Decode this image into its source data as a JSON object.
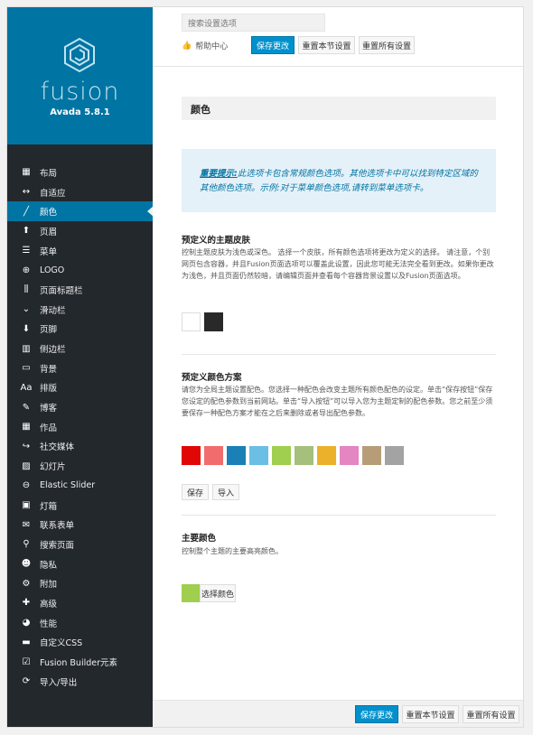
{
  "brand": {
    "name": "fusion",
    "version": "Avada 5.8.1"
  },
  "nav": [
    {
      "label": "布局",
      "icon": "grid-icon",
      "glyph": "▦"
    },
    {
      "label": "自适应",
      "icon": "arrows-horizontal-icon",
      "glyph": "↔"
    },
    {
      "label": "颜色",
      "icon": "brush-icon",
      "glyph": "╱",
      "active": true
    },
    {
      "label": "页眉",
      "icon": "arrow-up-icon",
      "glyph": "⬆"
    },
    {
      "label": "菜单",
      "icon": "menu-icon",
      "glyph": "☰"
    },
    {
      "label": "LOGO",
      "icon": "plus-circle-icon",
      "glyph": "⊕"
    },
    {
      "label": "页面标题栏",
      "icon": "sliders-icon",
      "glyph": "⫼"
    },
    {
      "label": "滑动栏",
      "icon": "chevron-down-icon",
      "glyph": "⌄"
    },
    {
      "label": "页脚",
      "icon": "arrow-down-icon",
      "glyph": "⬇"
    },
    {
      "label": "侧边栏",
      "icon": "columns-icon",
      "glyph": "▥"
    },
    {
      "label": "背景",
      "icon": "monitor-icon",
      "glyph": "▭"
    },
    {
      "label": "排版",
      "icon": "typography-icon",
      "glyph": "Aa"
    },
    {
      "label": "博客",
      "icon": "edit-icon",
      "glyph": "✎"
    },
    {
      "label": "作品",
      "icon": "portfolio-grid-icon",
      "glyph": "▦"
    },
    {
      "label": "社交媒体",
      "icon": "share-icon",
      "glyph": "↪"
    },
    {
      "label": "幻灯片",
      "icon": "image-icon",
      "glyph": "▨"
    },
    {
      "label": "Elastic Slider",
      "icon": "minus-circle-icon",
      "glyph": "⊖"
    },
    {
      "label": "灯箱",
      "icon": "lightbox-icon",
      "glyph": "▣"
    },
    {
      "label": "联系表单",
      "icon": "envelope-icon",
      "glyph": "✉"
    },
    {
      "label": "搜索页面",
      "icon": "search-icon",
      "glyph": "⚲"
    },
    {
      "label": "隐私",
      "icon": "user-icon",
      "glyph": "☻"
    },
    {
      "label": "附加",
      "icon": "cogs-icon",
      "glyph": "⚙"
    },
    {
      "label": "高级",
      "icon": "puzzle-icon",
      "glyph": "✚"
    },
    {
      "label": "性能",
      "icon": "dashboard-icon",
      "glyph": "◕"
    },
    {
      "label": "自定义CSS",
      "icon": "css-icon",
      "glyph": "▬"
    },
    {
      "label": "Fusion Builder元素",
      "icon": "checkbox-icon",
      "glyph": "☑"
    },
    {
      "label": "导入/导出",
      "icon": "refresh-icon",
      "glyph": "⟳"
    }
  ],
  "topbar": {
    "search_placeholder": "搜索设置选项",
    "help": "帮助中心",
    "save": "保存更改",
    "reset_section": "重置本节设置",
    "reset_all": "重置所有设置"
  },
  "section": {
    "title": "颜色"
  },
  "notice": {
    "strong": "重要提示:",
    "text": "此选项卡包含常规颜色选项。其他选项卡中可以找到特定区域的其他颜色选项。示例:对于菜单颜色选项,请转到菜单选项卡。"
  },
  "skin": {
    "title": "预定义的主题皮肤",
    "desc": "控制主题皮肤为浅色或深色。 选择一个皮肤，所有颜色选项将更改为定义的选择。 请注意，个别网页包含容器，并且Fusion页面选项可以覆盖此设置，因此您可能无法完全看到更改。如果你更改为浅色，并且页面仍然较暗，请编辑页面并查看每个容器背景设置以及Fusion页面选项。",
    "options": [
      {
        "name": "light",
        "color": "#ffffff"
      },
      {
        "name": "dark",
        "color": "#29292a"
      }
    ]
  },
  "scheme": {
    "title": "预定义颜色方案",
    "desc": "请您为全局主题设置配色。您选择一种配色会改变主题所有颜色配色的设定。单击“保存按钮”保存您设定的配色参数到当前网站。单击“导入按钮”可以导入您为主题定制的配色参数。您之前至少须要保存一种配色方案才能在之后来删除或者导出配色参数。",
    "colors": [
      "#e10707",
      "#f16d6d",
      "#1a80b6",
      "#6cbfe4",
      "#a0ce4e",
      "#a4c07c",
      "#ecb12b",
      "#e486c1",
      "#b79d77",
      "#a3a3a3"
    ],
    "save": "保存",
    "import": "导入"
  },
  "primary": {
    "title": "主要颜色",
    "desc": "控制整个主题的主要高亮颜色。",
    "color": "#a0ce4e",
    "button": "选择颜色"
  },
  "bottombar": {
    "save": "保存更改",
    "reset_section": "重置本节设置",
    "reset_all": "重置所有设置"
  }
}
